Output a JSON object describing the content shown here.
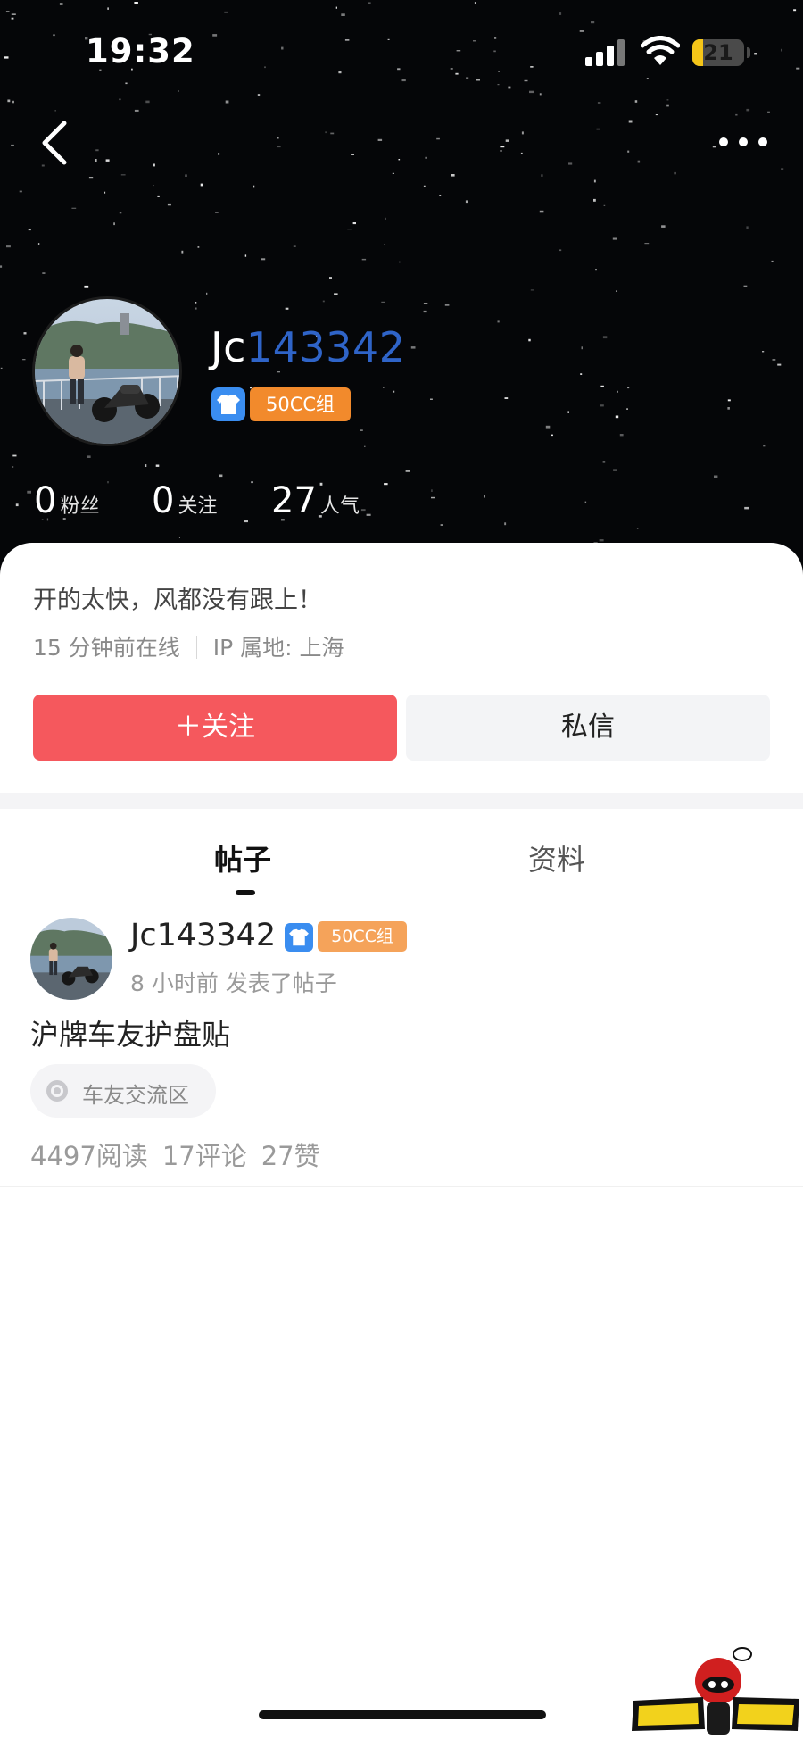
{
  "status_bar": {
    "time": "19:32",
    "battery_level": "21",
    "battery_fraction": 0.21,
    "signal_bars": 3
  },
  "nav": {
    "back_icon": "chevron-left-icon",
    "more_icon": "more-dots-icon"
  },
  "profile": {
    "username_prefix": "Jc",
    "username_highlight": "143342",
    "badge_icon": "tshirt-icon",
    "level": "50CC组",
    "stats": [
      {
        "value": "0",
        "label": "粉丝"
      },
      {
        "value": "0",
        "label": "关注"
      },
      {
        "value": "27",
        "label": "人气"
      }
    ],
    "bio": "开的太快，风都没有跟上！",
    "last_online": "15 分钟前在线",
    "ip_location": "IP 属地: 上海"
  },
  "actions": {
    "follow_label": "＋关注",
    "message_label": "私信"
  },
  "tabs": [
    {
      "label": "帖子",
      "active": true
    },
    {
      "label": "资料",
      "active": false
    }
  ],
  "posts": [
    {
      "username": "Jc143342",
      "level": "50CC组",
      "time": "8 小时前 发表了帖子",
      "title": "沪牌车友护盘贴",
      "forum": "车友交流区",
      "reads": "4497阅读",
      "comments": "17评论",
      "likes": "27赞"
    }
  ],
  "colors": {
    "header_bg": "#050608",
    "follow_button": "#f5585d",
    "username_highlight": "#2f64c8",
    "level_badge": "#f28a2c",
    "shirt_badge": "#3a8df0"
  }
}
